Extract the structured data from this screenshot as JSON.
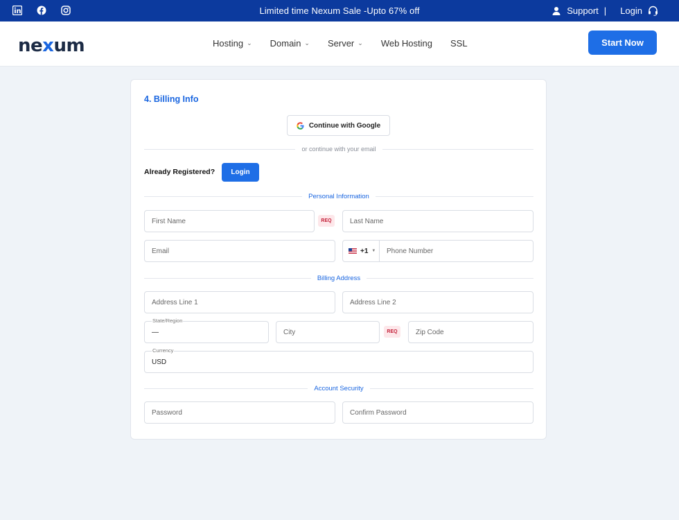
{
  "topbar": {
    "social_icons": [
      "linkedin-icon",
      "facebook-icon",
      "instagram-icon"
    ],
    "promo": "Limited time Nexum Sale -Upto 67% off",
    "support": "Support",
    "separator": "|",
    "login": "Login"
  },
  "header": {
    "logo_left": "ne",
    "logo_x": "x",
    "logo_right": "um",
    "nav": [
      {
        "label": "Hosting",
        "dropdown": true
      },
      {
        "label": "Domain",
        "dropdown": true
      },
      {
        "label": "Server",
        "dropdown": true
      },
      {
        "label": "Web Hosting",
        "dropdown": false
      },
      {
        "label": "SSL",
        "dropdown": false
      }
    ],
    "cta": "Start Now"
  },
  "form": {
    "title": "4. Billing Info",
    "google_button": "Continue with Google",
    "or_text": "or continue with your email",
    "already_registered": "Already Registered?",
    "login_button": "Login",
    "sections": {
      "personal": "Personal Information",
      "billing": "Billing Address",
      "security": "Account Security"
    },
    "req_label": "REQ",
    "fields": {
      "first_name": "First Name",
      "last_name": "Last Name",
      "email": "Email",
      "phone_prefix": "+1",
      "phone": "Phone Number",
      "address1": "Address Line 1",
      "address2": "Address Line 2",
      "state_label": "State/Region",
      "state_value": "—",
      "city": "City",
      "zip": "Zip Code",
      "currency_label": "Currency",
      "currency_value": "USD",
      "password": "Password",
      "confirm_password": "Confirm Password"
    }
  },
  "colors": {
    "brand_blue": "#1e6ee6",
    "topbar_bg": "#0c3a9e",
    "req_bg": "#fde7ea",
    "req_text": "#c4223a"
  }
}
